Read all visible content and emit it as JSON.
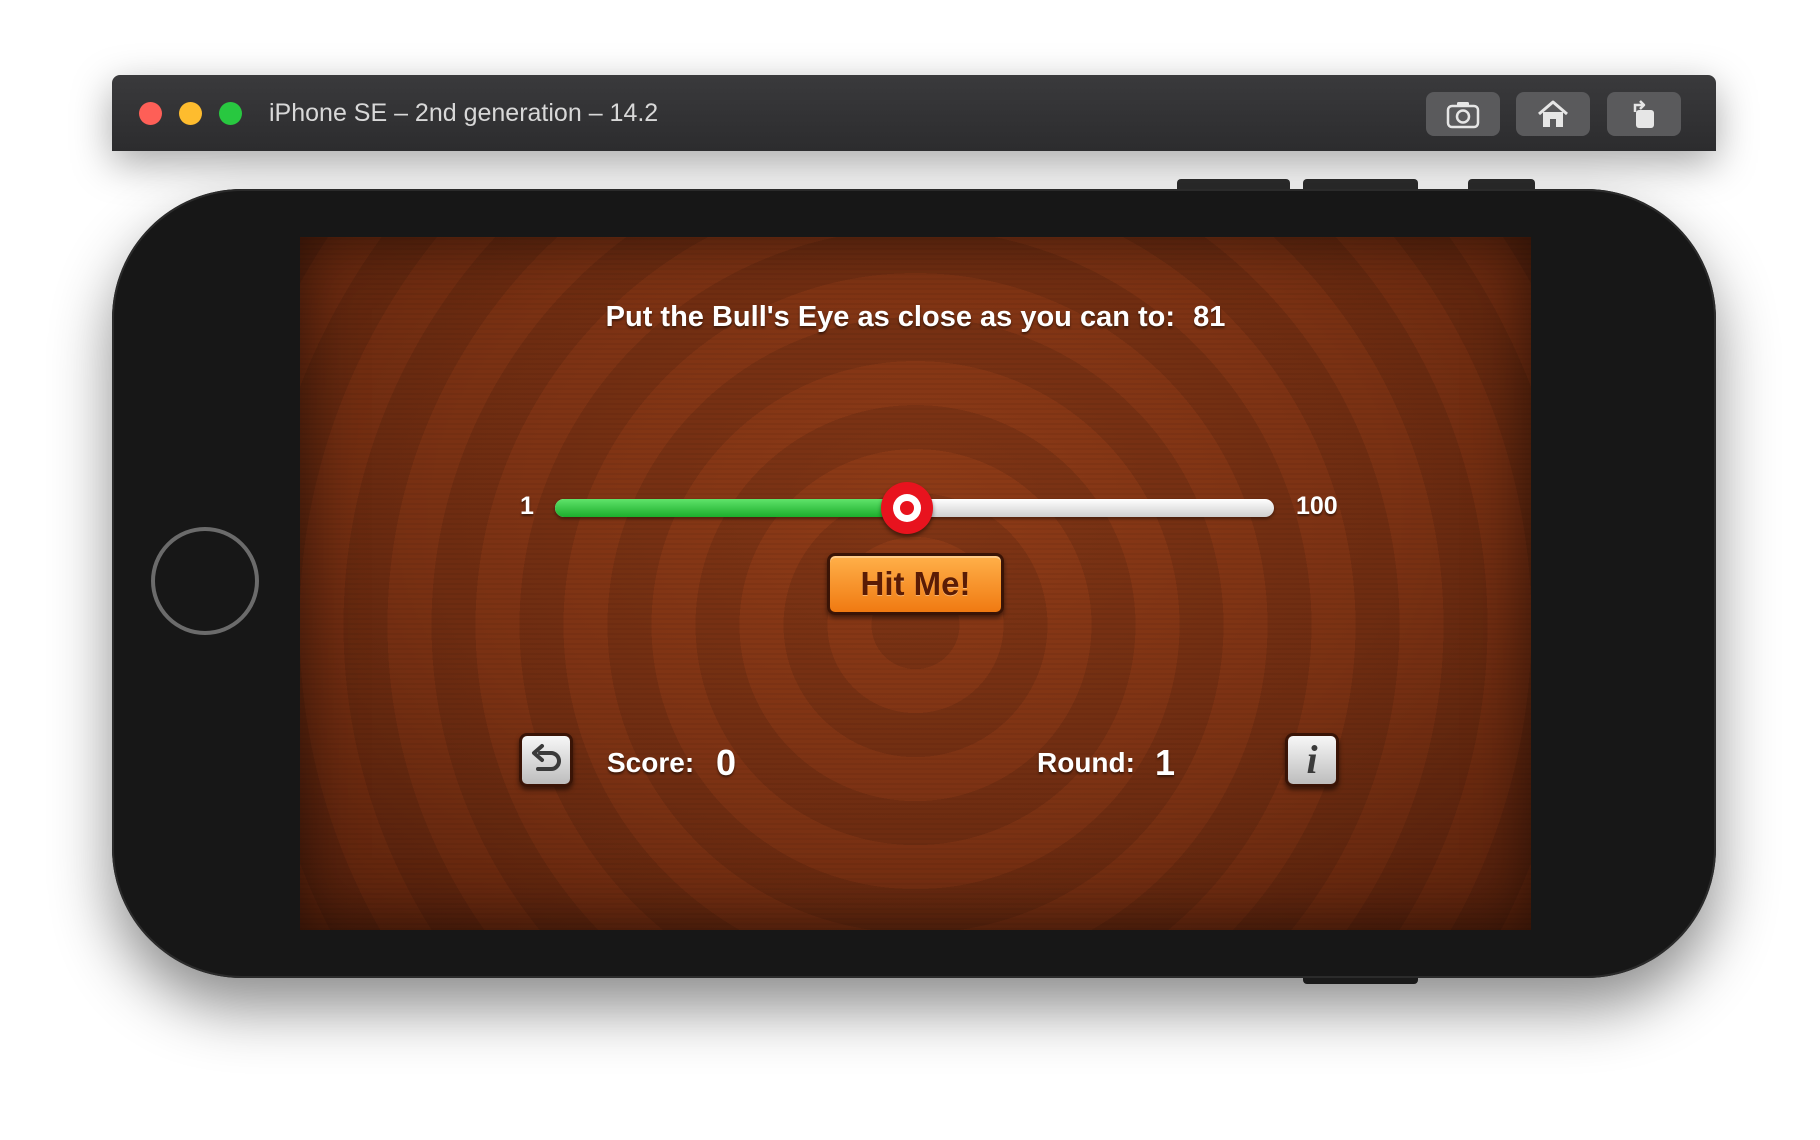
{
  "window": {
    "title": "iPhone SE – 2nd generation – 14.2",
    "toolbar": {
      "screenshot_icon": "camera-icon",
      "home_icon": "home-icon",
      "rotate_icon": "rotate-icon"
    }
  },
  "game": {
    "prompt": "Put the Bull's Eye as close as you can to:",
    "target_value": "81",
    "slider": {
      "min_label": "1",
      "max_label": "100",
      "value_fraction": 0.49,
      "fill_color": "#1cae2c",
      "thumb_color": "#e8131e"
    },
    "hit_button_label": "Hit Me!",
    "start_over_icon": "start-over-icon",
    "info_icon": "info-icon",
    "info_glyph": "i",
    "score_label": "Score:",
    "score_value": "0",
    "round_label": "Round:",
    "round_value": "1"
  }
}
